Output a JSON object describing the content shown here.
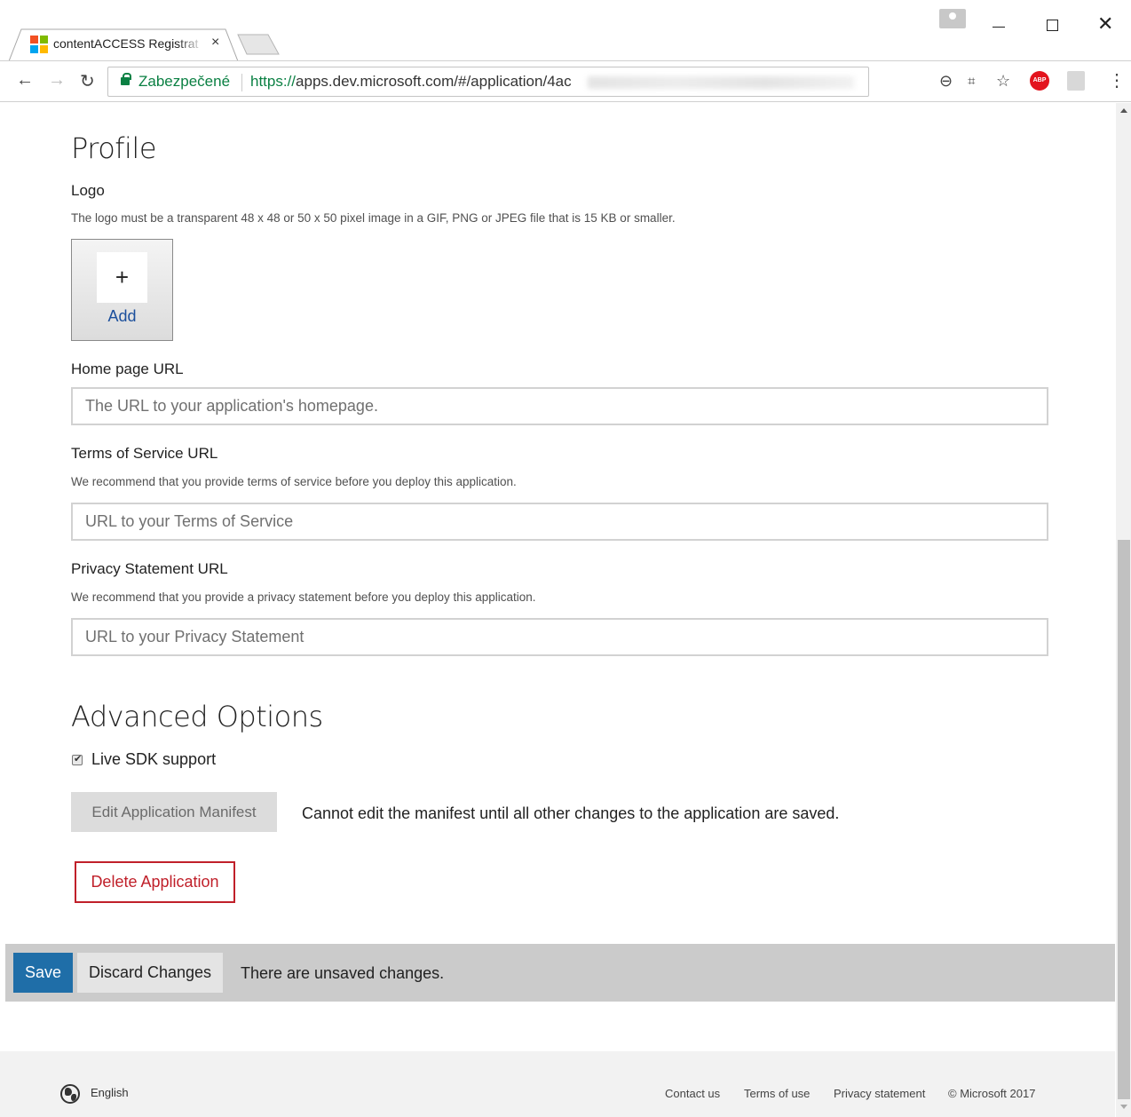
{
  "browser": {
    "tab_title": "contentACCESS Registrat",
    "secure_label": "Zabezpečené",
    "url_scheme": "https://",
    "url_rest": "apps.dev.microsoft.com/#/application/4ac",
    "icons": [
      "back-arrow-icon",
      "forward-arrow-icon",
      "reload-icon",
      "lock-icon",
      "zoom-icon",
      "translate-icon",
      "star-icon",
      "adblock-icon",
      "pdf-icon",
      "menu-icon"
    ]
  },
  "profile": {
    "heading": "Profile",
    "logo_label": "Logo",
    "logo_hint": "The logo must be a transparent 48 x 48 or 50 x 50 pixel image in a GIF, PNG or JPEG file that is 15 KB or smaller.",
    "add_label": "Add",
    "homepage_label": "Home page URL",
    "homepage_placeholder": "The URL to your application's homepage.",
    "tos_label": "Terms of Service URL",
    "tos_hint": "We recommend that you provide terms of service before you deploy this application.",
    "tos_placeholder": "URL to your Terms of Service",
    "privacy_label": "Privacy Statement URL",
    "privacy_hint": "We recommend that you provide a privacy statement before you deploy this application.",
    "privacy_placeholder": "URL to your Privacy Statement"
  },
  "advanced": {
    "heading": "Advanced Options",
    "live_sdk_label": "Live SDK support",
    "live_sdk_checked": true,
    "edit_manifest_label": "Edit Application Manifest",
    "manifest_note": "Cannot edit the manifest until all other changes to the application are saved.",
    "delete_label": "Delete Application"
  },
  "save_bar": {
    "save_label": "Save",
    "discard_label": "Discard Changes",
    "status": "There are unsaved changes."
  },
  "footer": {
    "language": "English",
    "links": [
      "Contact us",
      "Terms of use",
      "Privacy statement"
    ],
    "copyright": "© Microsoft 2017"
  },
  "colors": {
    "primary": "#1f6ea8",
    "danger": "#c0202a",
    "secure_green": "#0b8043"
  }
}
